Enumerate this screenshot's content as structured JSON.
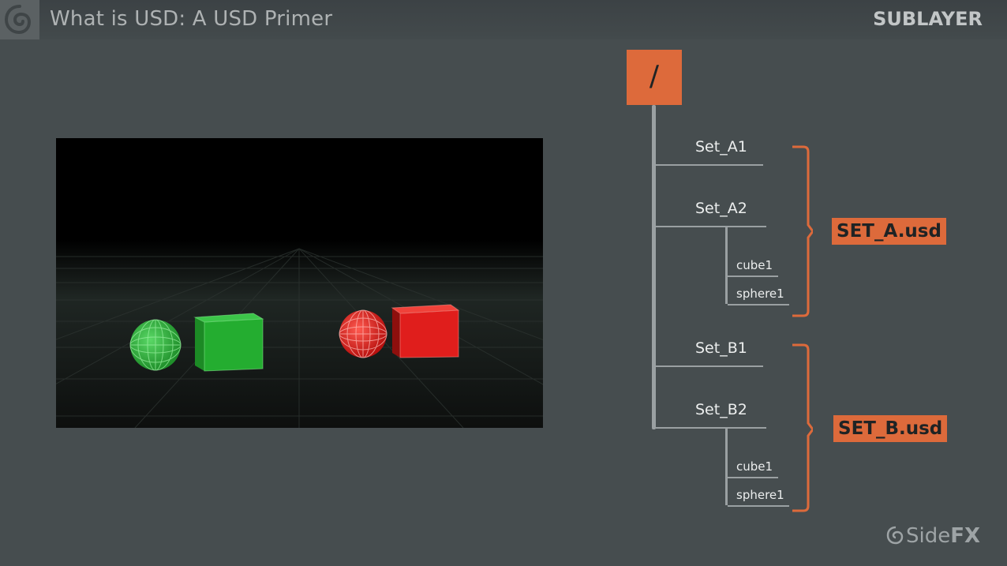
{
  "header": {
    "title": "What is USD: A USD Primer",
    "section": "SUBLAYER"
  },
  "tree": {
    "root": "/",
    "groups": [
      {
        "sets": [
          {
            "name": "Set_A1",
            "children": []
          },
          {
            "name": "Set_A2",
            "children": [
              "cube1",
              "sphere1"
            ]
          }
        ],
        "file": "SET_A.usd"
      },
      {
        "sets": [
          {
            "name": "Set_B1",
            "children": []
          },
          {
            "name": "Set_B2",
            "children": [
              "cube1",
              "sphere1"
            ]
          }
        ],
        "file": "SET_B.usd"
      }
    ]
  },
  "viewport": {
    "objects": [
      "green-sphere",
      "green-cube",
      "red-sphere",
      "red-cube"
    ]
  },
  "brand": {
    "name": "Side",
    "suffix": "FX"
  },
  "colors": {
    "background": "#464d4f",
    "accent": "#dd6a3b",
    "green": "#2eb13a",
    "red": "#e3201e"
  }
}
